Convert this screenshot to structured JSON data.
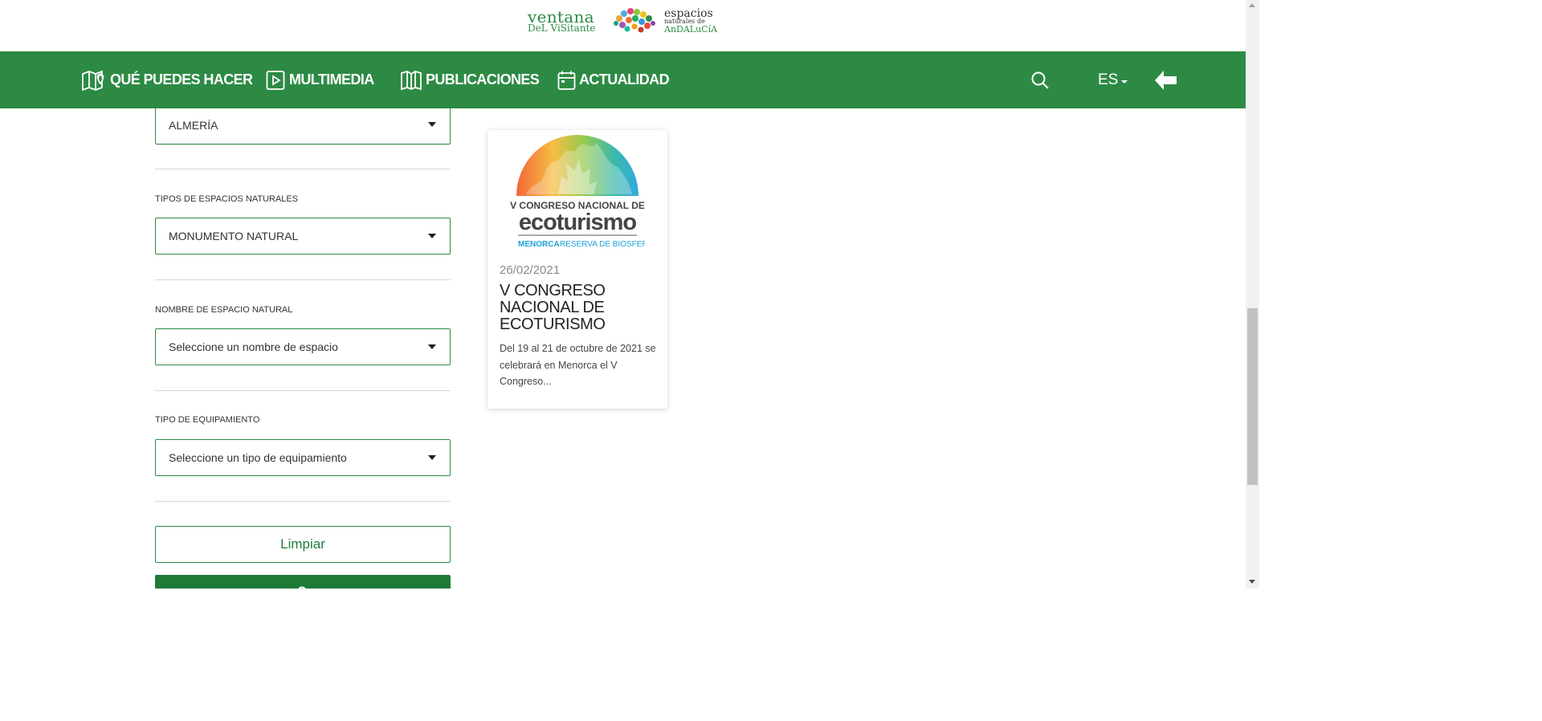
{
  "header": {
    "logo_line1": "ventana",
    "logo_line2": "DeL ViSitante",
    "logo_espacios": "espacios",
    "logo_naturales": "naturales de",
    "logo_andalucia": "AnDALuCíA"
  },
  "nav": {
    "items": [
      {
        "label": "QUÉ PUEDES HACER",
        "icon": "map-icon"
      },
      {
        "label": "MULTIMEDIA",
        "icon": "play-icon"
      },
      {
        "label": "PUBLICACIONES",
        "icon": "book-icon"
      },
      {
        "label": "ACTUALIDAD",
        "icon": "calendar-icon"
      }
    ],
    "language": "ES",
    "brand_color": "#2d8a44"
  },
  "filters": {
    "province_value": "ALMERÍA",
    "tipos_label": "TIPOS DE ESPACIOS NATURALES",
    "tipos_value": "MONUMENTO NATURAL",
    "nombre_label": "NOMBRE DE ESPACIO NATURAL",
    "nombre_value": "Seleccione un nombre de espacio",
    "equipamiento_label": "TIPO DE EQUIPAMIENTO",
    "equipamiento_value": "Seleccione un tipo de equipamiento",
    "clear_button": "Limpiar"
  },
  "card": {
    "image_line1": "V CONGRESO NACIONAL DE",
    "image_line2": "ecoturismo",
    "image_line3_a": "MENORCA",
    "image_line3_b": "RESERVA DE BIOSFERA",
    "date": "26/02/2021",
    "title": "V CONGRESO NACIONAL DE ECOTURISMO",
    "excerpt": "Del 19 al 21 de octubre de 2021 se celebrará en Menorca el V Congreso..."
  }
}
